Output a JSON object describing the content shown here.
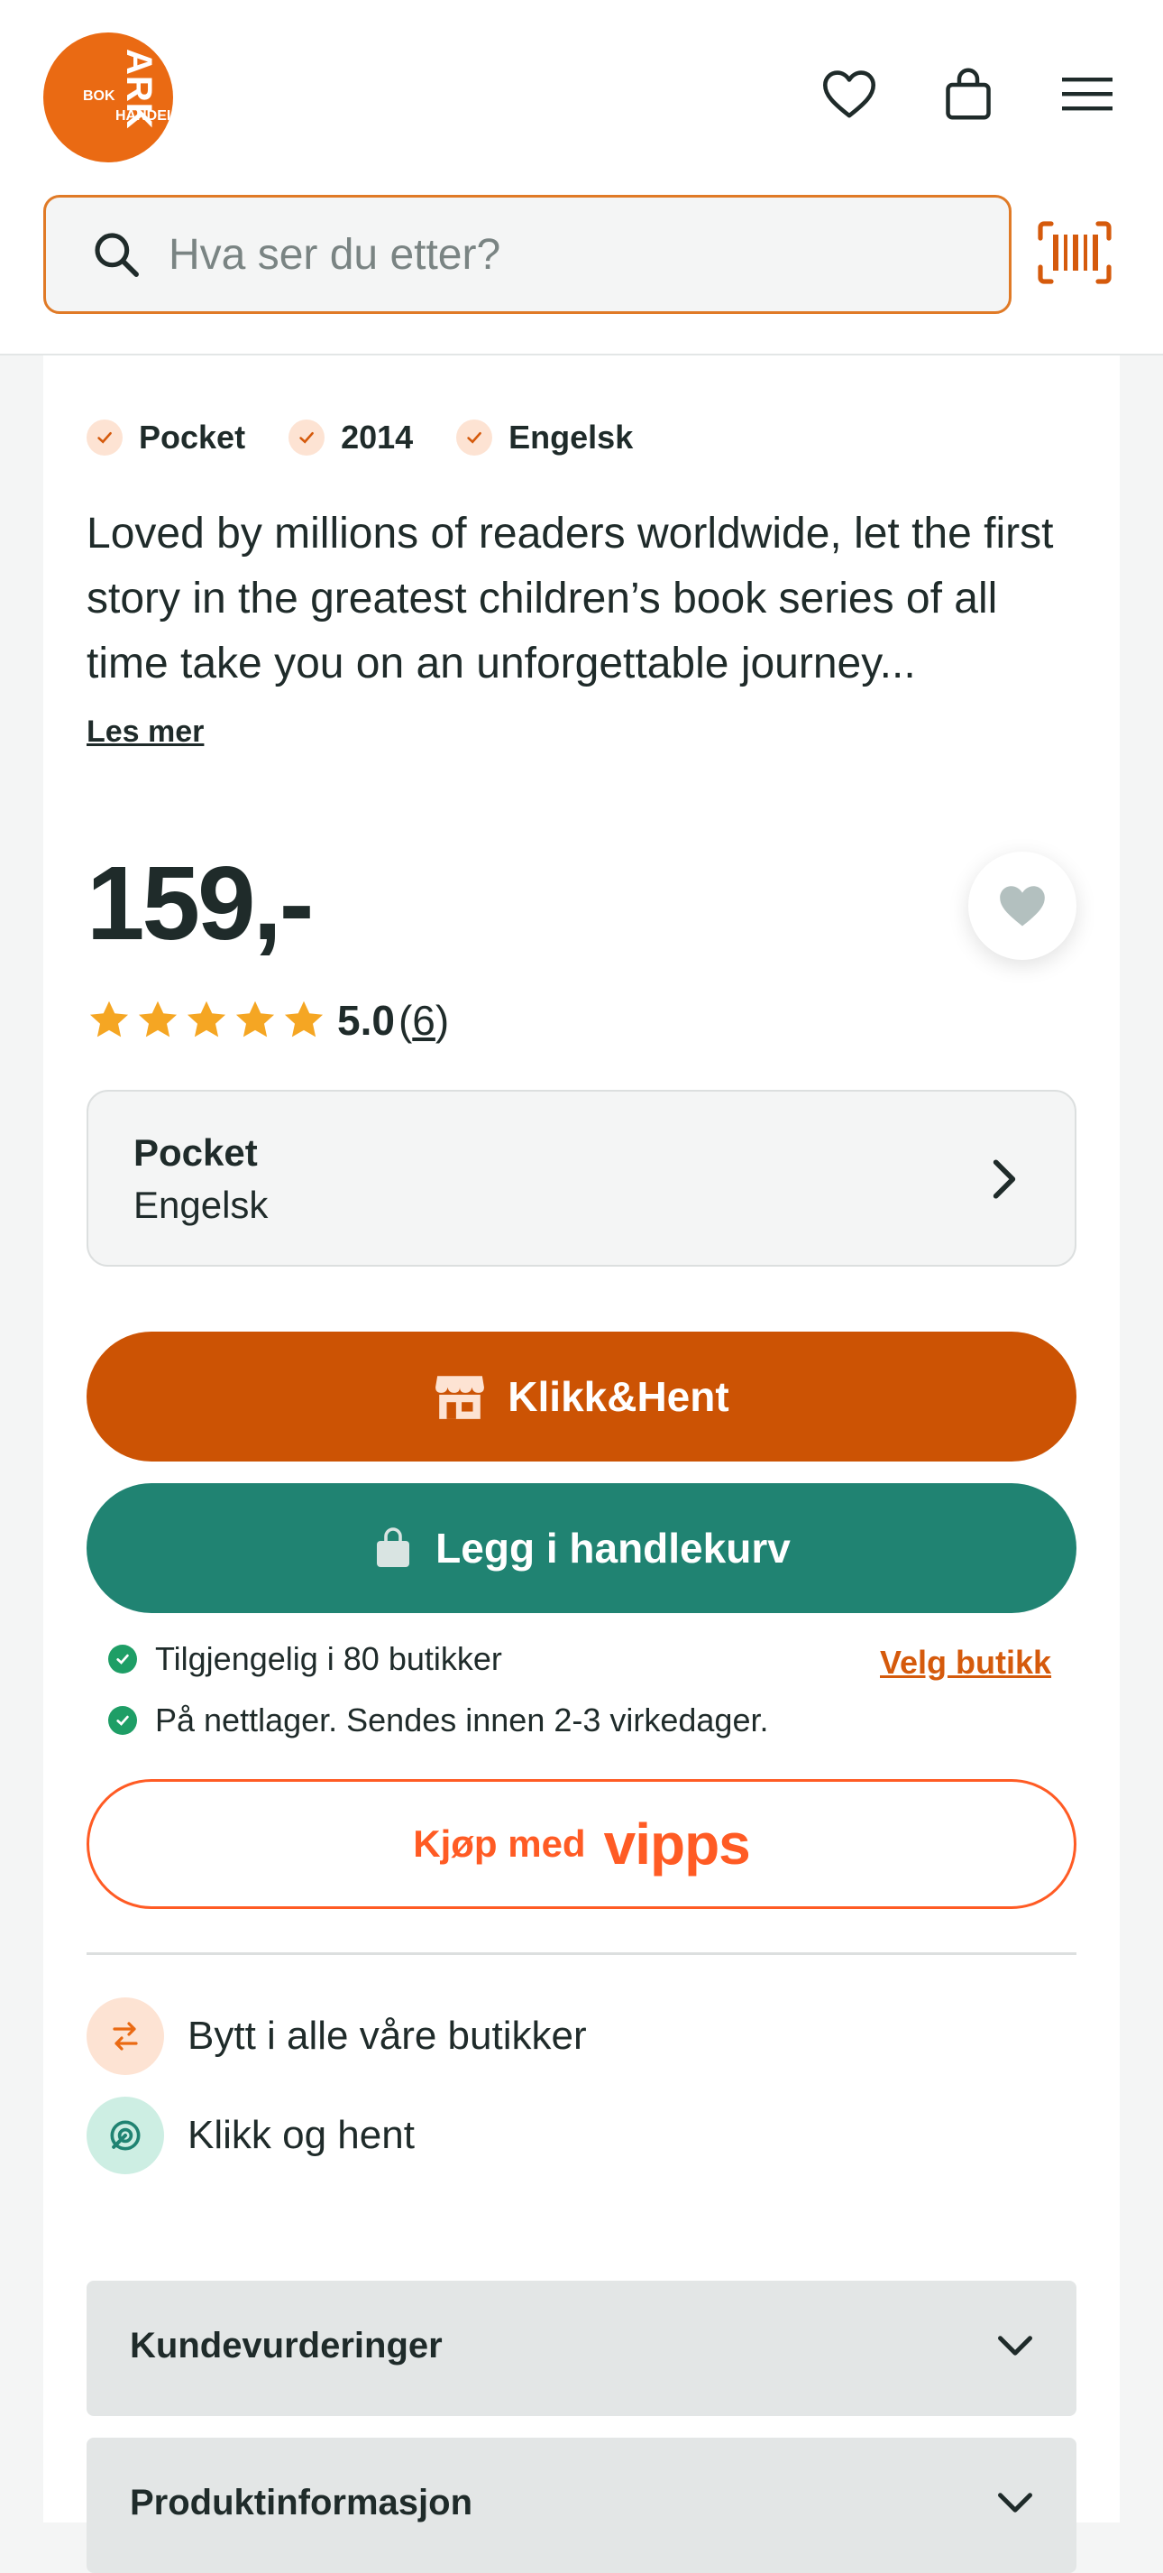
{
  "header": {
    "logo": {
      "line1": "ARK",
      "line2": "BOK",
      "line3": "HANDEL"
    },
    "search_placeholder": "Hva ser du etter?"
  },
  "product": {
    "tags": [
      "Pocket",
      "2014",
      "Engelsk"
    ],
    "description": "Loved by millions of readers worldwide, let the first story in the greatest children’s book series of all time take you on an unforgettable journey...",
    "read_more": "Les mer",
    "price": "159,-",
    "rating": {
      "value": "5.0",
      "count": "6",
      "stars": 5
    },
    "variant": {
      "format": "Pocket",
      "language": "Engelsk"
    }
  },
  "actions": {
    "click_collect": "Klikk&Hent",
    "add_to_cart": "Legg i handlekurv",
    "vipps_prefix": "Kjøp med",
    "vipps_brand": "vipps"
  },
  "availability": {
    "stores": "Tilgjengelig i 80 butikker",
    "choose_store": "Velg butikk",
    "online": "På nettlager. Sendes innen 2-3 virkedager."
  },
  "perks": [
    {
      "label": "Bytt i alle våre butikker",
      "icon": "exchange-icon"
    },
    {
      "label": "Klikk og hent",
      "icon": "pickup-icon"
    }
  ],
  "accordions": [
    {
      "title": "Kundevurderinger"
    },
    {
      "title": "Produktinformasjon"
    }
  ],
  "colors": {
    "brand_orange": "#ea6a13",
    "click_collect": "#cc5304",
    "cart_green": "#208372",
    "vipps": "#ff5b24",
    "star": "#f5a623"
  }
}
